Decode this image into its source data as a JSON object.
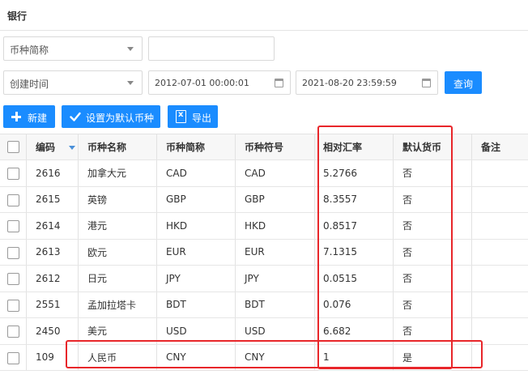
{
  "page": {
    "title": "银行"
  },
  "filters": {
    "field_select": "币种简称",
    "field_value": "",
    "time_select": "创建时间",
    "date_from": "2012-07-01 00:00:01",
    "date_to": "2021-08-20 23:59:59",
    "query_label": "查询"
  },
  "toolbar": {
    "new_label": "新建",
    "set_default_label": "设置为默认币种",
    "export_label": "导出"
  },
  "table": {
    "headers": {
      "code": "编码",
      "name": "币种名称",
      "abbr": "币种简称",
      "symbol": "币种符号",
      "rate": "相对汇率",
      "default": "默认货币",
      "remark": "备注"
    },
    "rows": [
      {
        "code": "2616",
        "name": "加拿大元",
        "abbr": "CAD",
        "symbol": "CAD",
        "rate": "5.2766",
        "default": "否"
      },
      {
        "code": "2615",
        "name": "英镑",
        "abbr": "GBP",
        "symbol": "GBP",
        "rate": "8.3557",
        "default": "否"
      },
      {
        "code": "2614",
        "name": "港元",
        "abbr": "HKD",
        "symbol": "HKD",
        "rate": "0.8517",
        "default": "否"
      },
      {
        "code": "2613",
        "name": "欧元",
        "abbr": "EUR",
        "symbol": "EUR",
        "rate": "7.1315",
        "default": "否"
      },
      {
        "code": "2612",
        "name": "日元",
        "abbr": "JPY",
        "symbol": "JPY",
        "rate": "0.0515",
        "default": "否"
      },
      {
        "code": "2551",
        "name": "孟加拉塔卡",
        "abbr": "BDT",
        "symbol": "BDT",
        "rate": "0.076",
        "default": "否"
      },
      {
        "code": "2450",
        "name": "美元",
        "abbr": "USD",
        "symbol": "USD",
        "rate": "6.682",
        "default": "否"
      },
      {
        "code": "109",
        "name": "人民币",
        "abbr": "CNY",
        "symbol": "CNY",
        "rate": "1",
        "default": "是"
      }
    ]
  },
  "colors": {
    "accent": "#1a8cff",
    "highlight": "#e8262a"
  }
}
